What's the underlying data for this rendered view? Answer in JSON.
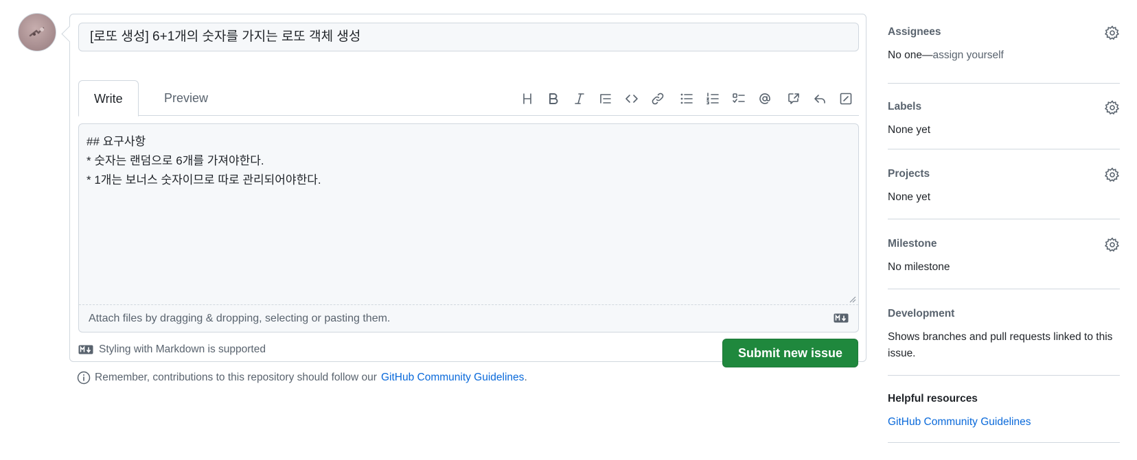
{
  "issue": {
    "title_value": "[로또 생성] 6+1개의 숫자를 가지는 로또 객체 생성",
    "tabs": [
      {
        "label": "Write",
        "active": true
      },
      {
        "label": "Preview",
        "active": false
      }
    ],
    "toolbar_icons": [
      "heading-icon",
      "bold-icon",
      "italic-icon",
      "quote-icon",
      "code-icon",
      "link-icon",
      "unordered-list-icon",
      "ordered-list-icon",
      "task-list-icon",
      "mention-icon",
      "cross-reference-icon",
      "reply-icon",
      "fullscreen-icon"
    ],
    "body_lines": [
      "## 요구사항",
      "* 숫자는 랜덤으로 6개를 가져야한다.",
      "* 1개는 보너스 숫자이므로 따로 관리되어야한다."
    ],
    "attach_text": "Attach files by dragging & dropping, selecting or pasting them.",
    "markdown_note": "Styling with Markdown is supported",
    "submit_label": "Submit new issue"
  },
  "remember": {
    "text": "Remember, contributions to this repository should follow our",
    "link": "GitHub Community Guidelines",
    "suffix": "."
  },
  "sidebar": {
    "assignees": {
      "heading": "Assignees",
      "value_prefix": "No one—",
      "value_link": "assign yourself"
    },
    "labels": {
      "heading": "Labels",
      "value": "None yet"
    },
    "projects": {
      "heading": "Projects",
      "value": "None yet"
    },
    "milestone": {
      "heading": "Milestone",
      "value": "No milestone"
    },
    "development": {
      "heading": "Development",
      "value": "Shows branches and pull requests linked to this issue."
    },
    "helpful": {
      "heading": "Helpful resources",
      "link": "GitHub Community Guidelines"
    }
  },
  "colors": {
    "submit_green": "#1f883d",
    "link_blue": "#0969da",
    "border": "#d0d7de",
    "muted_text": "#59636e"
  }
}
